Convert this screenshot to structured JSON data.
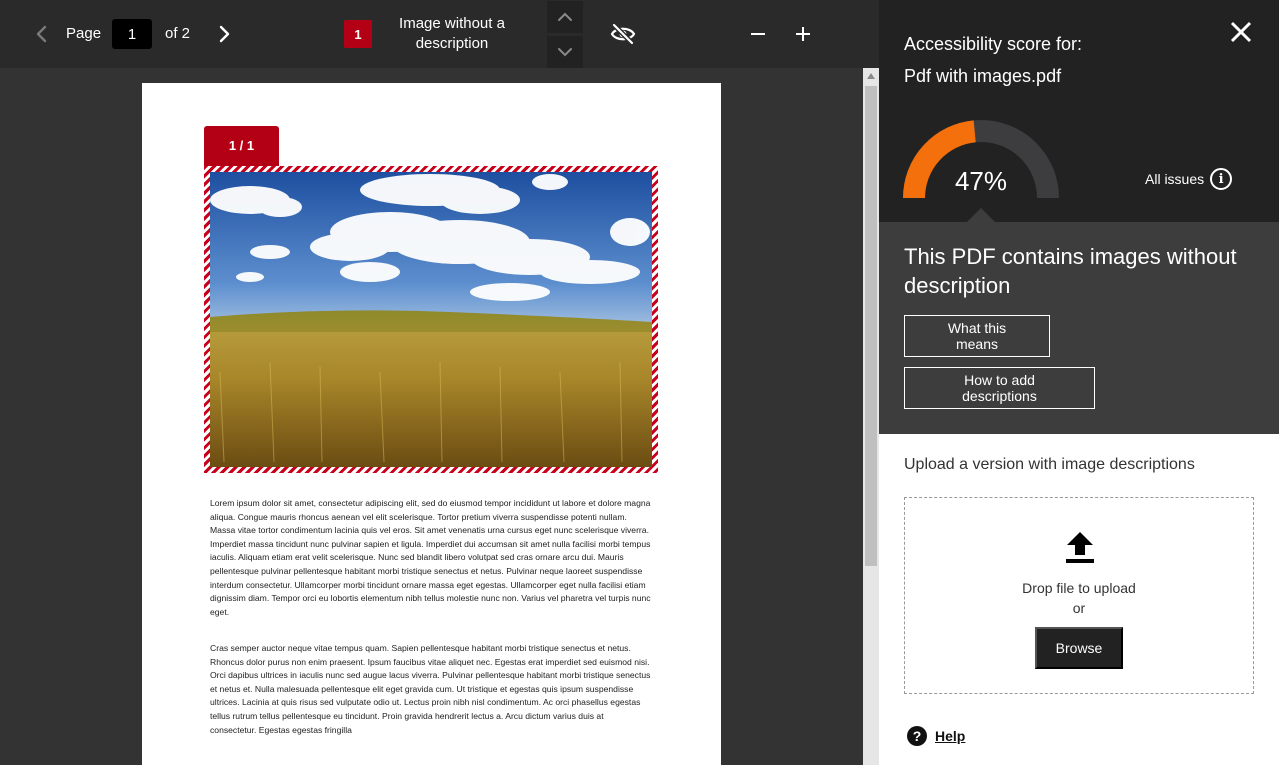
{
  "toolbar": {
    "page_label": "Page",
    "page_value": "1",
    "page_of": "of 2",
    "issue_badge": "1",
    "issue_title": "Image without a description",
    "icons": {
      "prev": "chevron-left-icon",
      "next": "chevron-right-icon",
      "issue_up": "chevron-up-icon",
      "issue_down": "chevron-down-icon",
      "visibility": "eye-slash-icon",
      "zoom_out": "minus-icon",
      "zoom_in": "plus-icon"
    }
  },
  "document": {
    "image_tab": "1 / 1",
    "paragraph_1": "Lorem ipsum dolor sit amet, consectetur adipiscing elit, sed do eiusmod tempor incididunt ut labore et dolore magna aliqua. Congue mauris rhoncus aenean vel elit scelerisque. Tortor pretium viverra suspendisse potenti nullam. Massa vitae tortor condimentum lacinia quis vel eros. Sit amet venenatis urna cursus eget nunc scelerisque viverra. Imperdiet massa tincidunt nunc pulvinar sapien et ligula. Imperdiet dui accumsan sit amet nulla facilisi morbi tempus iaculis. Aliquam etiam erat velit scelerisque. Nunc sed blandit libero volutpat sed cras ornare arcu dui. Mauris pellentesque pulvinar pellentesque habitant morbi tristique senectus et netus. Pulvinar neque laoreet suspendisse interdum consectetur. Ullamcorper morbi tincidunt ornare massa eget egestas. Ullamcorper eget nulla facilisi etiam dignissim diam. Tempor orci eu lobortis elementum nibh tellus molestie nunc non. Varius vel pharetra vel turpis nunc eget.",
    "paragraph_2": "Cras semper auctor neque vitae tempus quam. Sapien pellentesque habitant morbi tristique senectus et netus. Rhoncus dolor purus non enim praesent. Ipsum faucibus vitae aliquet nec. Egestas erat imperdiet sed euismod nisi. Orci dapibus ultrices in iaculis nunc sed augue lacus viverra. Pulvinar pellentesque habitant morbi tristique senectus et netus et. Nulla malesuada pellentesque elit eget gravida cum. Ut tristique et egestas quis ipsum suspendisse ultrices. Lacinia at quis risus sed vulputate odio ut. Lectus proin nibh nisl condimentum. Ac orci phasellus egestas tellus rutrum tellus pellentesque eu tincidunt. Proin gravida hendrerit lectus a. Arcu dictum varius duis at consectetur. Egestas egestas fringilla"
  },
  "panel": {
    "score_title_line1": "Accessibility score for:",
    "score_title_line2": "Pdf with images.pdf",
    "score_value": "47%",
    "score_fraction": 0.47,
    "score_color": "#f4700c",
    "track_color": "#3d3d3f",
    "all_issues_label": "All issues",
    "issue_heading": "This PDF contains images without description",
    "what_this_means": "What this means",
    "how_to_add": "How to add descriptions",
    "upload_label": "Upload a version with image descriptions",
    "drop_text": "Drop file to upload",
    "or_text": "or",
    "browse_label": "Browse",
    "help_label": "Help",
    "icons": {
      "close": "close-icon",
      "info": "info-icon",
      "upload": "upload-icon",
      "help": "help-icon"
    }
  },
  "colors": {
    "accent_red": "#b30015",
    "score_orange": "#f4700c",
    "dark_bg": "#222222",
    "issue_bg": "#3d3d3d"
  }
}
